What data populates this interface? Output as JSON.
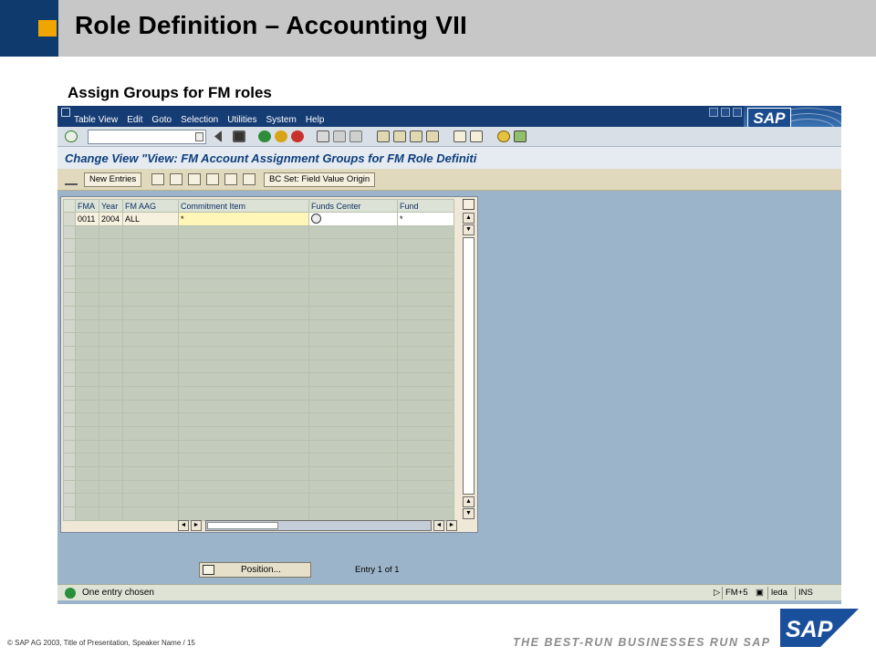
{
  "slide": {
    "title": "Role Definition – Accounting VII",
    "subtitle": "Assign Groups for FM roles",
    "copyright": "© SAP AG 2003, Title of Presentation, Speaker Name / 15",
    "tagline": "THE BEST-RUN BUSINESSES RUN SAP",
    "logo_text": "SAP"
  },
  "sap_window": {
    "logo_text": "SAP",
    "menu": {
      "items": [
        {
          "label": "Table View"
        },
        {
          "label": "Edit"
        },
        {
          "label": "Goto"
        },
        {
          "label": "Selection"
        },
        {
          "label": "Utilities"
        },
        {
          "label": "System"
        },
        {
          "label": "Help"
        }
      ]
    },
    "screen_title": "Change View \"View: FM Account Assignment Groups for FM Role Definiti",
    "app_toolbar": {
      "new_entries": "New Entries",
      "bc_set": "BC Set: Field Value Origin"
    },
    "table": {
      "columns": [
        "FMA",
        "Year",
        "FM AAG",
        "Commitment Item",
        "Funds Center",
        "Fund"
      ],
      "rows": [
        [
          "0011",
          "2004",
          "ALL",
          "*",
          "",
          "*"
        ]
      ],
      "empty_rows": 22
    },
    "position_button": "Position...",
    "entry_text": "Entry 1 of 1",
    "status": {
      "message": "One entry chosen",
      "system": "FM+5",
      "server": "leda",
      "mode": "INS"
    }
  },
  "colors": {
    "header_blue": "#0f3a6e",
    "header_orange": "#f0a500",
    "sap_menubar": "#163c74",
    "sap_background": "#9cb4c9"
  }
}
